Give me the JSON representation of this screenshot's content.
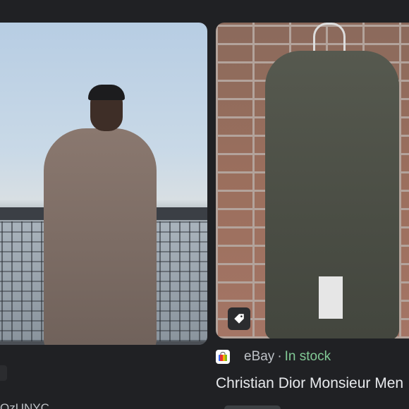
{
  "results": [
    {
      "image_description_icon": "man-in-trench-coat-image",
      "caption_partial": "OzUNYC"
    },
    {
      "image_description_icon": "green-trench-coat-on-brick-wall-image",
      "source": "eBay",
      "separator": "·",
      "stock_status": "In stock",
      "title": "Christian Dior Monsieur Men"
    }
  ],
  "icons": {
    "tag": "price-tag-icon",
    "favicon": "ebay-favicon"
  },
  "colors": {
    "background": "#202124",
    "in_stock": "#81c995",
    "source_text": "#bdc1c6",
    "title_text": "#e8eaed"
  }
}
